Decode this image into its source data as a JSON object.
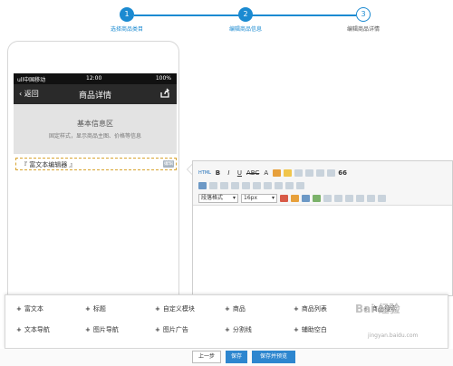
{
  "steps": [
    {
      "num": "1",
      "label": "选择商品类目",
      "state": "done"
    },
    {
      "num": "2",
      "label": "编辑商品信息",
      "state": "done"
    },
    {
      "num": "3",
      "label": "编辑商品详情",
      "state": "todo"
    }
  ],
  "phone": {
    "carrier": "ull中国移动",
    "time": "12:00",
    "battery": "100%",
    "back_label": "返回",
    "title": "商品详情",
    "info_title": "基本信息区",
    "info_sub": "固定样式，显示商品主图、价格等信息",
    "rich_text_label": "『 富文本编辑器 』",
    "rich_text_edit": "编辑"
  },
  "editor": {
    "html_label": "HTML",
    "bold": "B",
    "italic": "I",
    "underline": "U",
    "strike": "ABC",
    "font_color": "A",
    "quote": "66",
    "paragraph_format": "段落格式",
    "font_size": "16px"
  },
  "modules": [
    {
      "label": "富文本"
    },
    {
      "label": "标题"
    },
    {
      "label": "自定义模块"
    },
    {
      "label": "商品"
    },
    {
      "label": "商品列表"
    },
    {
      "label": "商品搜索"
    },
    {
      "label": "文本导航"
    },
    {
      "label": "图片导航"
    },
    {
      "label": "图片广告"
    },
    {
      "label": "分割线"
    },
    {
      "label": "辅助空白"
    }
  ],
  "buttons": {
    "prev": "上一步",
    "save": "保存",
    "save_preview": "保存并预览"
  },
  "watermark": {
    "logo": "Bai 经验",
    "url": "jingyan.baidu.com"
  },
  "colors": {
    "accent": "#1b8ad1",
    "primary_button": "#2d86cf",
    "navbar": "#2a2a2a",
    "info_bg": "#e3e3e3",
    "rich_border": "#d8a430"
  }
}
